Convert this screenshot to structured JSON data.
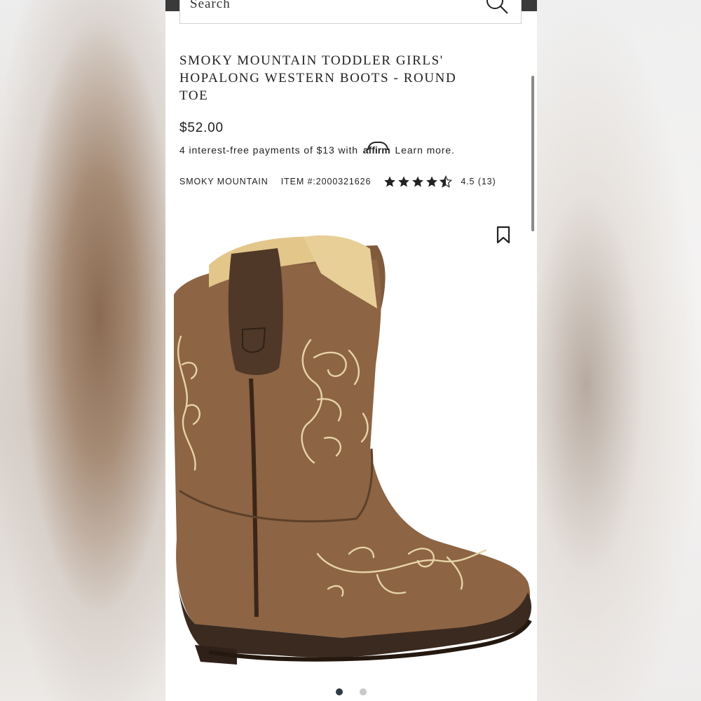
{
  "search": {
    "placeholder": "Search"
  },
  "product": {
    "title": "SMOKY MOUNTAIN TODDLER GIRLS' HOPALONG WESTERN BOOTS - ROUND TOE",
    "price": "$52.00",
    "financing": {
      "prefix": "4 interest-free payments of $13 with",
      "provider": "affirm",
      "link": "Learn more."
    },
    "brand": "SMOKY MOUNTAIN",
    "item_number": "ITEM #:2000321626",
    "rating": {
      "value": 4.5,
      "text": "4.5 (13)"
    }
  },
  "carousel": {
    "count": 2,
    "active_index": 0
  },
  "icons": [
    "search-icon",
    "bookmark-icon",
    "star-icon",
    "star-half-icon"
  ],
  "colors": {
    "topbar": "#3a3a3a",
    "text": "#222222",
    "dot_active": "#2f3b44",
    "dot_inactive": "#c9c9c9"
  }
}
